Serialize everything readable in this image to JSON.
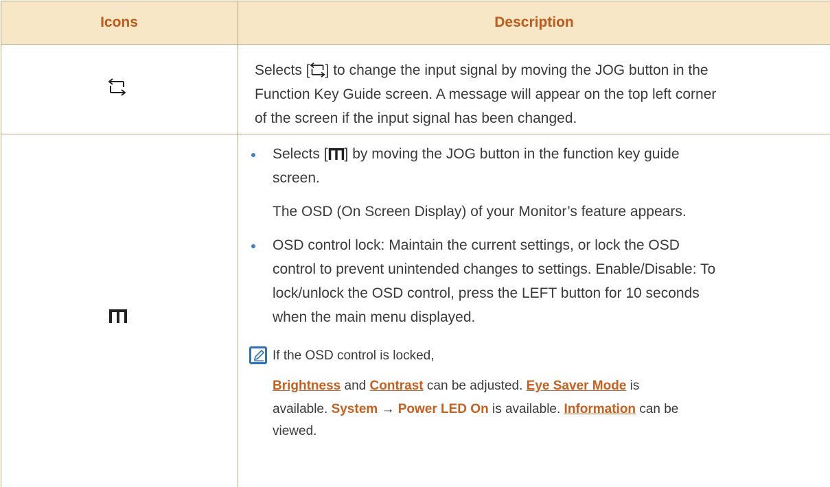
{
  "header": {
    "col_icons": "Icons",
    "col_description": "Description"
  },
  "row1": {
    "icon": "source-icon",
    "line1_pre": "Selects [",
    "line1_post": "] to change the input signal by moving the JOG button in the",
    "line2": "Function Key Guide screen. A message will appear on the top left corner",
    "line3": "of the screen if the input signal has been changed."
  },
  "row2": {
    "icon": "menu-icon",
    "b1_line1_pre": "Selects [",
    "b1_line1_post": "] by moving the JOG button in the function key guide",
    "b1_line2": "screen.",
    "b1_sub": "The OSD (On Screen Display) of your Monitor’s feature appears.",
    "b2_line1": "OSD control lock: Maintain the current settings, or lock the OSD",
    "b2_line2": "control to prevent unintended changes to settings. Enable/Disable: To",
    "b2_line3": "lock/unlock the OSD control, press the LEFT button for 10 seconds",
    "b2_line4": "when the main menu displayed.",
    "note_icon": "note-pencil-icon",
    "note_line1": "If the OSD control is locked,",
    "note_brightness": "Brightness",
    "note_and": " and ",
    "note_contrast": "Contrast",
    "note_adjusted": " can be adjusted. ",
    "note_eye": "Eye Saver Mode",
    "note_is": " is",
    "note_available1": "available. ",
    "note_system": "System",
    "note_arrow": "→",
    "note_power": "Power LED On",
    "note_available2": " is available. ",
    "note_information": "Information",
    "note_canbe": " can be",
    "note_viewed": "viewed."
  },
  "colors": {
    "header_bg": "#f7e7c6",
    "header_text": "#bd5a1c",
    "link": "#c95f1e",
    "bullet": "#3d82c4",
    "note_icon": "#2f72b8"
  }
}
